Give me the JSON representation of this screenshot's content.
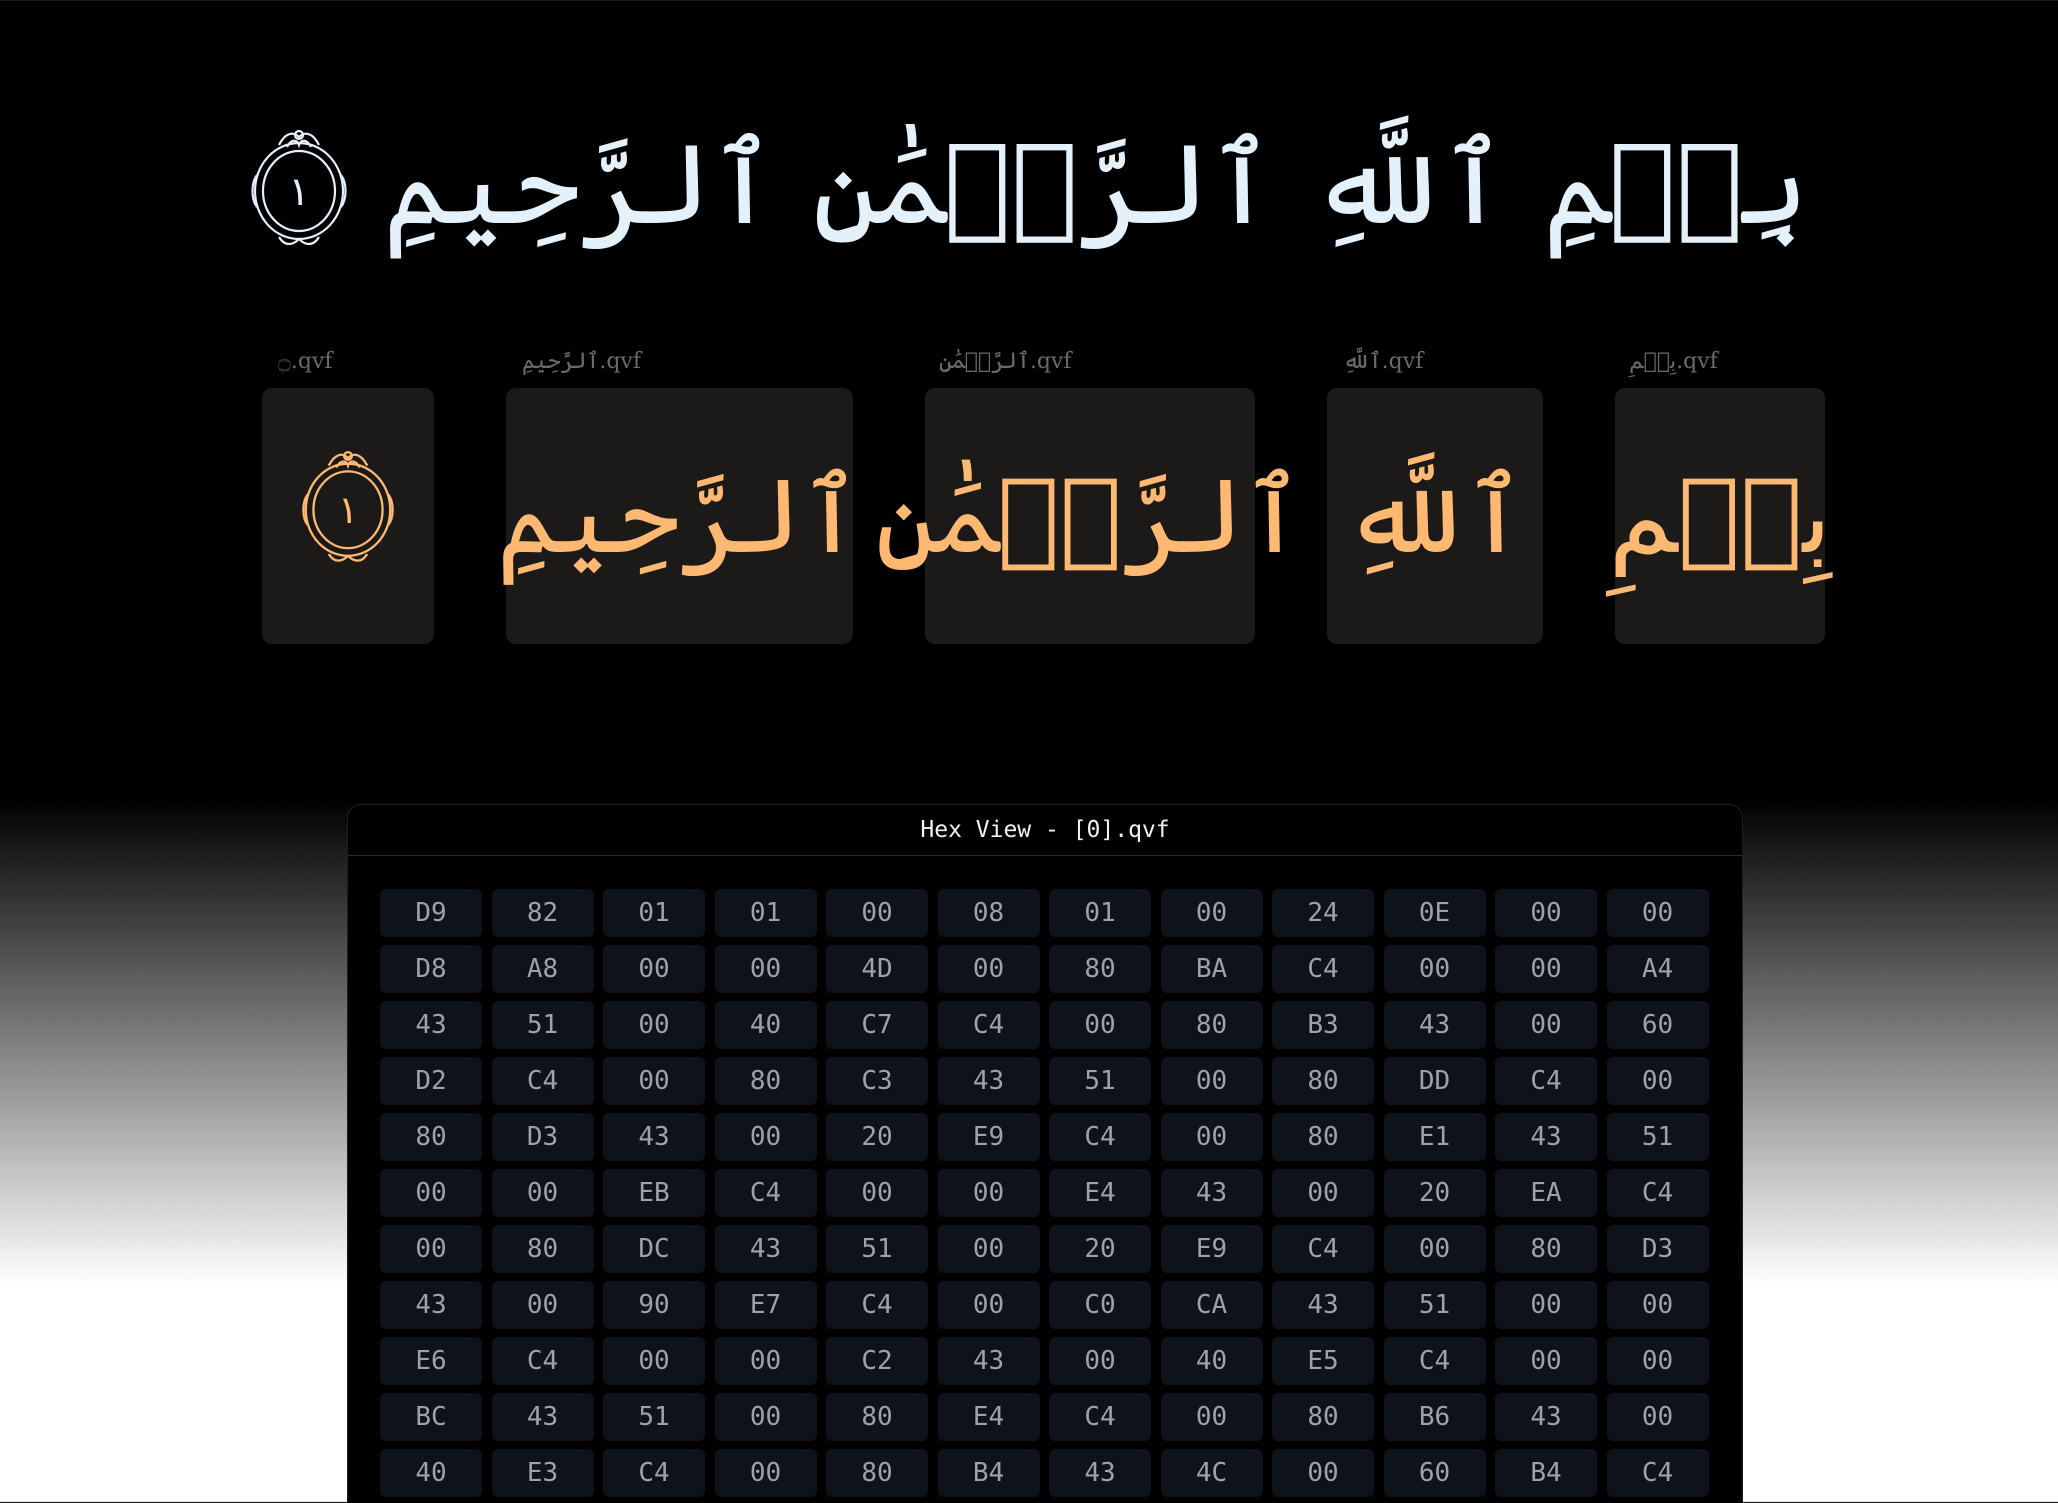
{
  "banner": {
    "verse_text": "بِسۡمِ ٱللَّهِ ٱلرَّحۡمَٰنِ ٱلرَّحِيمِ",
    "ayah_number": "١",
    "color": "#e4f1fb"
  },
  "cards": [
    {
      "caption": "بِسۡمِ.qvf",
      "glyph": "بِسۡمِ"
    },
    {
      "caption": "ٱللَّهِ.qvf",
      "glyph": "ٱللَّهِ"
    },
    {
      "caption": "ٱلرَّحۡمَٰنِ.qvf",
      "glyph": "ٱلرَّحۡمَٰنِ"
    },
    {
      "caption": "ٱلرَّحِيمِ.qvf",
      "glyph": "ٱلرَّحِيمِ"
    },
    {
      "caption": "۝.qvf",
      "ayah_number": "١",
      "icon": "ayah-end-ornament-icon"
    }
  ],
  "card_glyph_color": "#fdb872",
  "hex_view": {
    "title": "Hex View - [0].qvf",
    "rows": [
      [
        "D9",
        "82",
        "01",
        "01",
        "00",
        "08",
        "01",
        "00",
        "24",
        "0E",
        "00",
        "00"
      ],
      [
        "D8",
        "A8",
        "00",
        "00",
        "4D",
        "00",
        "80",
        "BA",
        "C4",
        "00",
        "00",
        "A4"
      ],
      [
        "43",
        "51",
        "00",
        "40",
        "C7",
        "C4",
        "00",
        "80",
        "B3",
        "43",
        "00",
        "60"
      ],
      [
        "D2",
        "C4",
        "00",
        "80",
        "C3",
        "43",
        "51",
        "00",
        "80",
        "DD",
        "C4",
        "00"
      ],
      [
        "80",
        "D3",
        "43",
        "00",
        "20",
        "E9",
        "C4",
        "00",
        "80",
        "E1",
        "43",
        "51"
      ],
      [
        "00",
        "00",
        "EB",
        "C4",
        "00",
        "00",
        "E4",
        "43",
        "00",
        "20",
        "EA",
        "C4"
      ],
      [
        "00",
        "80",
        "DC",
        "43",
        "51",
        "00",
        "20",
        "E9",
        "C4",
        "00",
        "80",
        "D3"
      ],
      [
        "43",
        "00",
        "90",
        "E7",
        "C4",
        "00",
        "C0",
        "CA",
        "43",
        "51",
        "00",
        "00"
      ],
      [
        "E6",
        "C4",
        "00",
        "00",
        "C2",
        "43",
        "00",
        "40",
        "E5",
        "C4",
        "00",
        "00"
      ],
      [
        "BC",
        "43",
        "51",
        "00",
        "80",
        "E4",
        "C4",
        "00",
        "80",
        "B6",
        "43",
        "00"
      ],
      [
        "40",
        "E3",
        "C4",
        "00",
        "80",
        "B4",
        "43",
        "4C",
        "00",
        "60",
        "B4",
        "C4"
      ]
    ]
  }
}
